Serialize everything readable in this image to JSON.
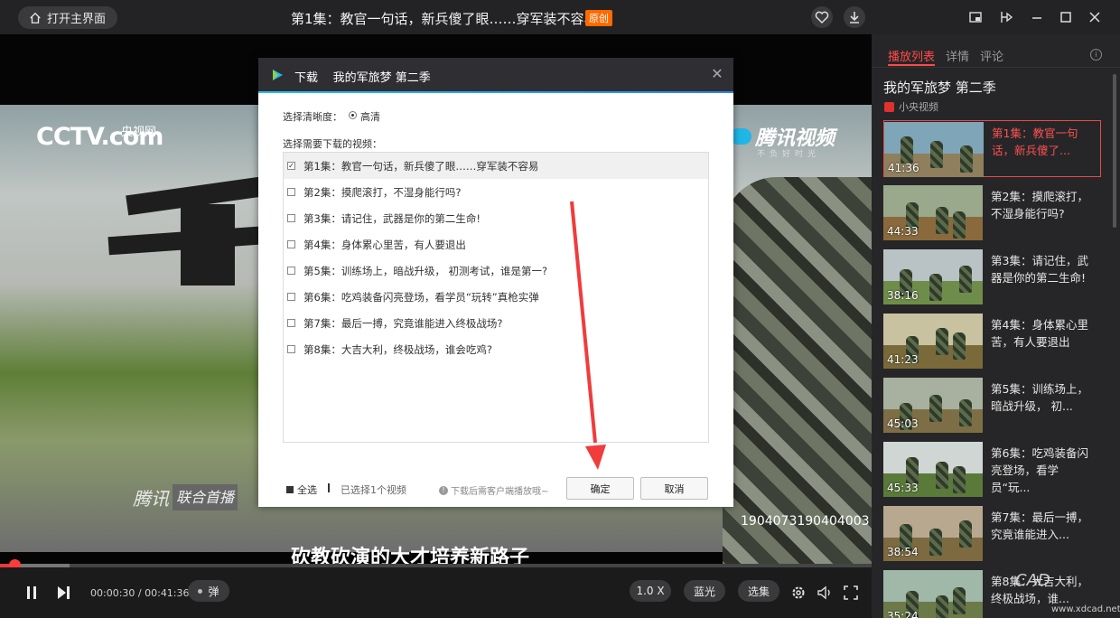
{
  "titlebar": {
    "home_label": "打开主界面",
    "title": "第1集：教官一句话，新兵傻了眼……穿军装不容易",
    "badge": "原创"
  },
  "video": {
    "logo_cctv": "CCTV.com",
    "logo_cctv_cn": "央视网",
    "logo_tencent": "腾讯视频",
    "logo_tencent_sub": "不负好时光",
    "logo_bottom_brand": "腾讯",
    "logo_bottom_tag": "联合首播",
    "code": "1904073190404003",
    "subtitle": "砍教砍演的大才培养新路子",
    "current_time": "00:00:30",
    "total_time": "00:41:36",
    "progress": 0.012,
    "buffer": 0.08
  },
  "controls": {
    "danmu_label": "弹",
    "speed_label": "1.0 X",
    "quality_label": "蓝光",
    "episodes_label": "选集"
  },
  "dialog": {
    "header_label": "下载",
    "header_series": "我的军旅梦 第二季",
    "quality_label": "选择清晰度：",
    "quality_value": "高清",
    "videos_label": "选择需要下载的视频：",
    "episodes": [
      {
        "label": "第1集：教官一句话，新兵傻了眼……穿军装不容易",
        "checked": true
      },
      {
        "label": "第2集：摸爬滚打，不湿身能行吗?",
        "checked": false
      },
      {
        "label": "第3集：请记住，武器是你的第二生命!",
        "checked": false
      },
      {
        "label": "第4集：身体累心里苦，有人要退出",
        "checked": false
      },
      {
        "label": "第5集：训练场上，暗战升级， 初测考试，谁是第一?",
        "checked": false
      },
      {
        "label": "第6集：吃鸡装备闪亮登场，看学员“玩转”真枪实弹",
        "checked": false
      },
      {
        "label": "第7集：最后一搏，究竟谁能进入终极战场?",
        "checked": false
      },
      {
        "label": "第8集：大吉大利，终极战场，谁会吃鸡?",
        "checked": false
      }
    ],
    "select_all_label": "全选",
    "selected_count": "已选择1个视频",
    "hint": "下载后需客户端播放哦~",
    "confirm_label": "确定",
    "cancel_label": "取消"
  },
  "sidebar": {
    "tabs": [
      "播放列表",
      "详情",
      "评论"
    ],
    "series_name": "我的军旅梦 第二季",
    "source": "小央视频",
    "episodes": [
      {
        "title": "第1集：教官一句话，新兵傻了...",
        "duration": "41:36",
        "active": true
      },
      {
        "title": "第2集：摸爬滚打，不湿身能行吗?",
        "duration": "44:33",
        "active": false
      },
      {
        "title": "第3集：请记住，武器是你的第二生命!",
        "duration": "38:16",
        "active": false
      },
      {
        "title": "第4集：身体累心里苦，有人要退出",
        "duration": "41:23",
        "active": false
      },
      {
        "title": "第5集：训练场上，暗战升级， 初...",
        "duration": "45:03",
        "active": false
      },
      {
        "title": "第6集：吃鸡装备闪亮登场，看学员“玩...",
        "duration": "45:33",
        "active": false
      },
      {
        "title": "第7集：最后一搏，究竟谁能进入...",
        "duration": "38:54",
        "active": false
      },
      {
        "title": "第8集：大吉大利，终极战场，谁...",
        "duration": "35:24",
        "active": false
      }
    ],
    "watermark": "CAD",
    "watermark_url": "www.xdcad.net"
  },
  "colors": {
    "accent": "#ff4a4a",
    "badge": "#ff6a00",
    "dialog_accent": "#23c0f0"
  }
}
